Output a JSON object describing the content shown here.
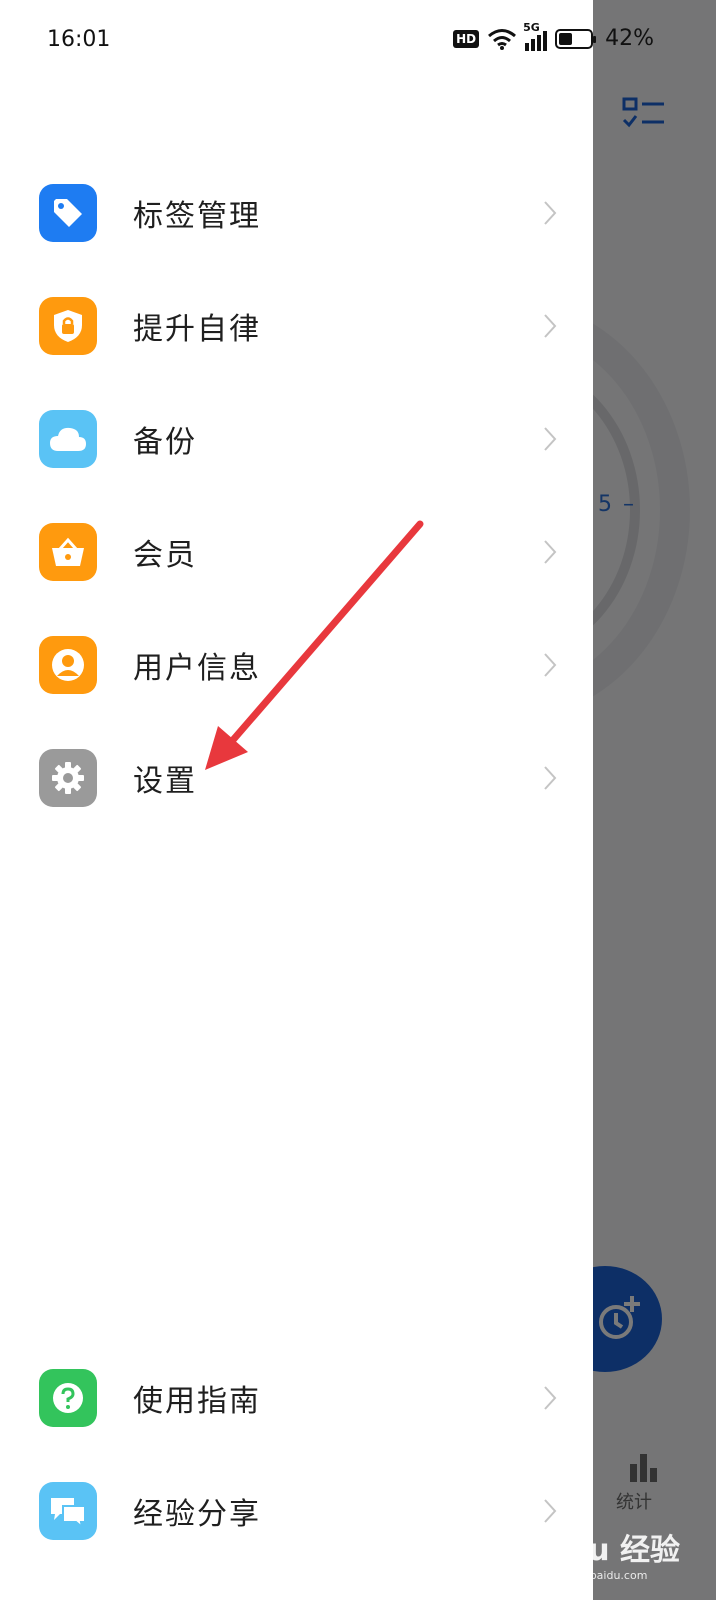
{
  "status_bar": {
    "time": "16:01",
    "network_label": "5G",
    "hd_label": "HD",
    "battery_percent": "42%",
    "battery_level": 0.42
  },
  "background_app": {
    "stats_label": "统计",
    "partial_text": "5 –",
    "accent_color": "#1d63d6"
  },
  "menu": {
    "items": [
      {
        "label": "标签管理",
        "icon": "tag-icon",
        "color": "#1e7cf2"
      },
      {
        "label": "提升自律",
        "icon": "shield-lock-icon",
        "color": "#ff9a0e"
      },
      {
        "label": "备份",
        "icon": "cloud-icon",
        "color": "#5ac3f5"
      },
      {
        "label": "会员",
        "icon": "basket-icon",
        "color": "#ff9a0e"
      },
      {
        "label": "用户信息",
        "icon": "user-circle-icon",
        "color": "#ff9a0e"
      },
      {
        "label": "设置",
        "icon": "gear-icon",
        "color": "#9a9a9a"
      }
    ],
    "bottom_items": [
      {
        "label": "使用指南",
        "icon": "question-icon",
        "color": "#33c45c"
      },
      {
        "label": "经验分享",
        "icon": "chat-bubbles-icon",
        "color": "#5ac3f5"
      }
    ]
  },
  "annotation": {
    "arrow_color": "#e8383d"
  },
  "watermark": {
    "text": "Baidu 经验",
    "sub": "jingyan.baidu.com"
  }
}
